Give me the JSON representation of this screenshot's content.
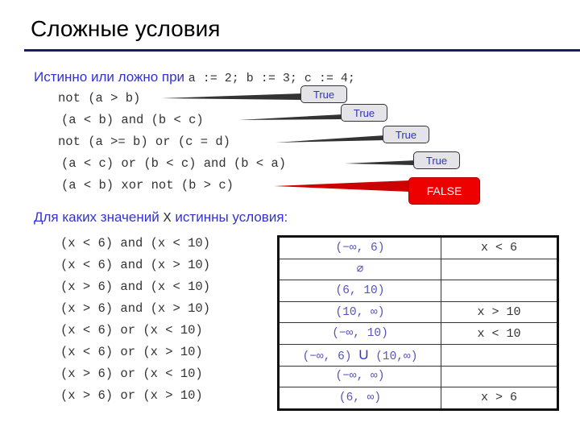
{
  "title": "Сложные условия",
  "section1": {
    "heading_text": "Истинно или ложно при",
    "heading_code": "a := 2;  b := 3;  c := 4;",
    "expressions": [
      {
        "code": "not (a > b)",
        "result": "True"
      },
      {
        "code": "(a < b) and (b < c)",
        "result": "True"
      },
      {
        "code": "not (a >= b) or (c = d)",
        "result": "True"
      },
      {
        "code": "(a < c) or (b < c) and (b < a)",
        "result": "True"
      },
      {
        "code": "(a < b) xor not (b > c)",
        "result": "FALSE"
      }
    ]
  },
  "section2": {
    "heading_before": "Для каких значений",
    "heading_var": "X",
    "heading_after": "истинны условия:",
    "conditions": [
      "(x < 6) and (x < 10)",
      "(x < 6) and (x > 10)",
      "(x > 6) and (x < 10)",
      "(x > 6) and (x > 10)",
      "(x < 6) or (x < 10)",
      "(x < 6) or (x > 10)",
      "(x > 6) or (x < 10)",
      "(x > 6) or (x > 10)"
    ],
    "answers": [
      {
        "interval": "(−∞, 6)",
        "simplified": "x < 6"
      },
      {
        "interval": "∅",
        "simplified": ""
      },
      {
        "interval": "(6, 10)",
        "simplified": ""
      },
      {
        "interval": "(10, ∞)",
        "simplified": "x > 10"
      },
      {
        "interval": "(−∞, 10)",
        "simplified": "x < 10"
      },
      {
        "interval_left": "(−∞, 6)",
        "union": "U",
        "interval_right": "(10,∞)",
        "simplified": ""
      },
      {
        "interval": "(−∞, ∞)",
        "simplified": ""
      },
      {
        "interval": "(6, ∞)",
        "simplified": "x > 6"
      }
    ]
  },
  "colors": {
    "heading": "#3333cc",
    "title_rule": "#1a1a6e",
    "true_bubble": "#e3e3e8",
    "false_bubble": "#ee0000"
  }
}
